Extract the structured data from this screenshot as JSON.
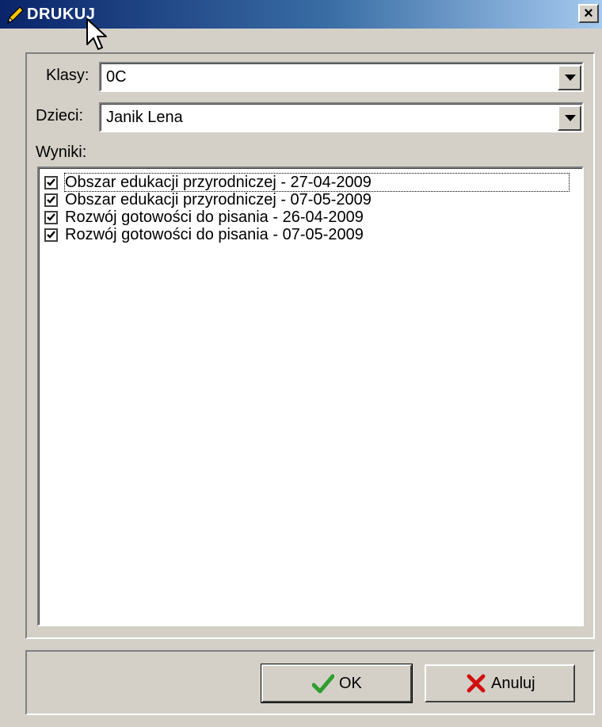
{
  "window": {
    "title": "DRUKUJ",
    "close_symbol": "×",
    "icons": {
      "title_icon": "pencil-icon",
      "close_icon": "close-icon"
    }
  },
  "form": {
    "klasy_label": "Klasy:",
    "klasy_value": "0C",
    "dzieci_label": "Dzieci:",
    "dzieci_value": "Janik Lena",
    "wyniki_label": "Wyniki:"
  },
  "results": [
    {
      "label": "Obszar edukacji przyrodniczej - 27-04-2009",
      "checked": true,
      "focused": true
    },
    {
      "label": "Obszar edukacji przyrodniczej - 07-05-2009",
      "checked": true,
      "focused": false
    },
    {
      "label": "Rozwój gotowości do pisania - 26-04-2009",
      "checked": true,
      "focused": false
    },
    {
      "label": "Rozwój gotowości do pisania - 07-05-2009",
      "checked": true,
      "focused": false
    }
  ],
  "buttons": {
    "ok_label": "OK",
    "cancel_label": "Anuluj",
    "ok_icon": "checkmark-icon",
    "cancel_icon": "red-x-icon"
  },
  "colors": {
    "title_gradient_start": "#0a246a",
    "title_gradient_end": "#a6caf0",
    "face": "#d4d0c8",
    "ok_check": "#2e9e2e",
    "cancel_x": "#d01010"
  }
}
